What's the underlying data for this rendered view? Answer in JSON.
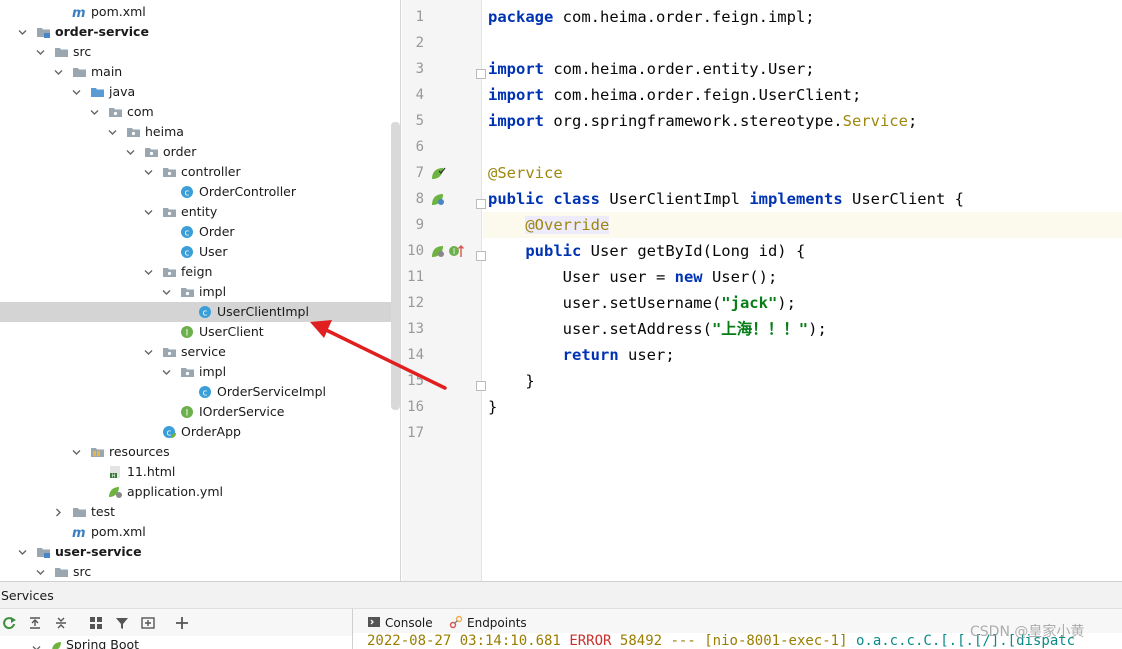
{
  "project_tree": [
    {
      "label": "pom.xml",
      "icon": "maven-icon",
      "depth": 3,
      "arrow": "none"
    },
    {
      "label": "order-service",
      "icon": "module-folder-icon",
      "depth": 1,
      "arrow": "down",
      "bold": true
    },
    {
      "label": "src",
      "icon": "folder-icon",
      "depth": 2,
      "arrow": "down"
    },
    {
      "label": "main",
      "icon": "folder-icon",
      "depth": 3,
      "arrow": "down"
    },
    {
      "label": "java",
      "icon": "source-folder-icon",
      "depth": 4,
      "arrow": "down"
    },
    {
      "label": "com",
      "icon": "package-icon",
      "depth": 5,
      "arrow": "down"
    },
    {
      "label": "heima",
      "icon": "package-icon",
      "depth": 6,
      "arrow": "down"
    },
    {
      "label": "order",
      "icon": "package-icon",
      "depth": 7,
      "arrow": "down"
    },
    {
      "label": "controller",
      "icon": "package-icon",
      "depth": 8,
      "arrow": "down"
    },
    {
      "label": "OrderController",
      "icon": "class-icon",
      "depth": 9,
      "arrow": "none"
    },
    {
      "label": "entity",
      "icon": "package-icon",
      "depth": 8,
      "arrow": "down"
    },
    {
      "label": "Order",
      "icon": "class-icon",
      "depth": 9,
      "arrow": "none"
    },
    {
      "label": "User",
      "icon": "class-icon",
      "depth": 9,
      "arrow": "none"
    },
    {
      "label": "feign",
      "icon": "package-icon",
      "depth": 8,
      "arrow": "down"
    },
    {
      "label": "impl",
      "icon": "package-icon",
      "depth": 9,
      "arrow": "down"
    },
    {
      "label": "UserClientImpl",
      "icon": "class-icon",
      "depth": 10,
      "arrow": "none",
      "selected": true
    },
    {
      "label": "UserClient",
      "icon": "interface-icon",
      "depth": 9,
      "arrow": "none"
    },
    {
      "label": "service",
      "icon": "package-icon",
      "depth": 8,
      "arrow": "down"
    },
    {
      "label": "impl",
      "icon": "package-icon",
      "depth": 9,
      "arrow": "down"
    },
    {
      "label": "OrderServiceImpl",
      "icon": "class-icon",
      "depth": 10,
      "arrow": "none"
    },
    {
      "label": "IOrderService",
      "icon": "interface-icon",
      "depth": 9,
      "arrow": "none"
    },
    {
      "label": "OrderApp",
      "icon": "spring-class-icon",
      "depth": 8,
      "arrow": "none"
    },
    {
      "label": "resources",
      "icon": "resources-folder-icon",
      "depth": 4,
      "arrow": "down"
    },
    {
      "label": "11.html",
      "icon": "html-file-icon",
      "depth": 5,
      "arrow": "none"
    },
    {
      "label": "application.yml",
      "icon": "yaml-file-icon",
      "depth": 5,
      "arrow": "none"
    },
    {
      "label": "test",
      "icon": "folder-icon",
      "depth": 3,
      "arrow": "right"
    },
    {
      "label": "pom.xml",
      "icon": "maven-icon",
      "depth": 3,
      "arrow": "none"
    },
    {
      "label": "user-service",
      "icon": "module-folder-icon",
      "depth": 1,
      "arrow": "down",
      "bold": true
    },
    {
      "label": "src",
      "icon": "folder-icon",
      "depth": 2,
      "arrow": "down"
    }
  ],
  "editor": {
    "line_numbers": [
      "1",
      "2",
      "3",
      "4",
      "5",
      "6",
      "7",
      "8",
      "9",
      "10",
      "11",
      "12",
      "13",
      "14",
      "15",
      "16",
      "17"
    ],
    "current_line": 9,
    "lines": [
      [
        {
          "t": "package",
          "c": "kw"
        },
        {
          "t": " com.heima.order.feign.impl;"
        }
      ],
      [],
      [
        {
          "t": "import",
          "c": "kw"
        },
        {
          "t": " com.heima.order.entity.User;"
        }
      ],
      [
        {
          "t": "import",
          "c": "kw"
        },
        {
          "t": " com.heima.order.feign.UserClient;"
        }
      ],
      [
        {
          "t": "import",
          "c": "kw"
        },
        {
          "t": " org.springframework.stereotype."
        },
        {
          "t": "Service",
          "c": "spr"
        },
        {
          "t": ";"
        }
      ],
      [],
      [
        {
          "t": "@Service",
          "c": "ann"
        }
      ],
      [
        {
          "t": "public",
          "c": "kw"
        },
        {
          "t": " "
        },
        {
          "t": "class",
          "c": "kw"
        },
        {
          "t": " UserClientImpl "
        },
        {
          "t": "implements",
          "c": "kw"
        },
        {
          "t": " UserClient {"
        }
      ],
      [
        {
          "t": "    "
        },
        {
          "t": "@Override",
          "c": "ann hl"
        }
      ],
      [
        {
          "t": "    "
        },
        {
          "t": "public",
          "c": "kw"
        },
        {
          "t": " User getById(Long id) {"
        }
      ],
      [
        {
          "t": "        User user = "
        },
        {
          "t": "new",
          "c": "kw"
        },
        {
          "t": " User();"
        }
      ],
      [
        {
          "t": "        user.setUsername("
        },
        {
          "t": "\"jack\"",
          "c": "str"
        },
        {
          "t": ");"
        }
      ],
      [
        {
          "t": "        user.setAddress("
        },
        {
          "t": "\"上海！！！\"",
          "c": "str"
        },
        {
          "t": ");"
        }
      ],
      [
        {
          "t": "        "
        },
        {
          "t": "return",
          "c": "kw"
        },
        {
          "t": " user;"
        }
      ],
      [
        {
          "t": "    }"
        }
      ],
      [
        {
          "t": "}"
        }
      ],
      []
    ]
  },
  "services": {
    "title": "Services",
    "tree_item": "Spring Boot",
    "tabs": {
      "console": "Console",
      "endpoints": "Endpoints"
    },
    "console": {
      "timestamp": "2022-08-27 03:14:10.681",
      "level": "ERROR",
      "pid": "58492",
      "sep": "---",
      "thread": "[nio-8001-exec-1]",
      "logger": "o.a.c.c.C.[.[.[/].[dispatc"
    }
  },
  "watermark": "CSDN @皇家小黄",
  "colors": {
    "keyword": "#0033b3",
    "annotation": "#9e880d",
    "string": "#067d17",
    "selection": "#d4d4d4",
    "arrow": "#e02020"
  }
}
